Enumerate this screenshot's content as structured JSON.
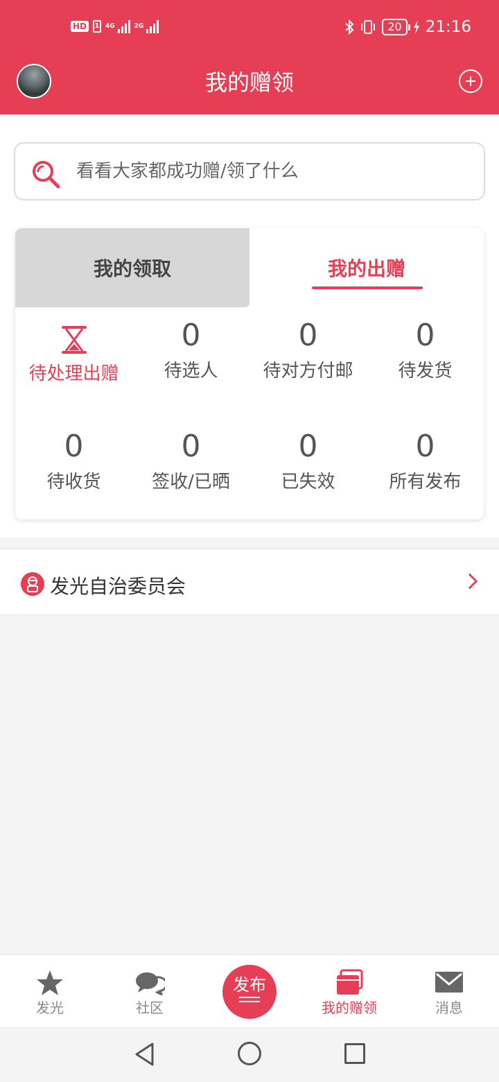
{
  "status_bar": {
    "hd": "HD",
    "sim1": "1",
    "net1": "4G",
    "net2": "2G",
    "battery": "20",
    "time": "21:16"
  },
  "header": {
    "title": "我的赠领"
  },
  "search": {
    "placeholder": "看看大家都成功赠/领了什么"
  },
  "tabs": [
    {
      "label": "我的领取"
    },
    {
      "label": "我的出赠",
      "active": true
    }
  ],
  "stats": [
    {
      "label": "待处理出赠",
      "icon": "hourglass-icon",
      "active": true
    },
    {
      "label": "待选人",
      "value": "0"
    },
    {
      "label": "待对方付邮",
      "value": "0"
    },
    {
      "label": "待发货",
      "value": "0"
    },
    {
      "label": "待收货",
      "value": "0"
    },
    {
      "label": "签收/已晒",
      "value": "0"
    },
    {
      "label": "已失效",
      "value": "0"
    },
    {
      "label": "所有发布",
      "value": "0"
    }
  ],
  "committee": {
    "label": "发光自治委员会"
  },
  "bottom_nav": {
    "items": [
      {
        "label": "发光",
        "icon": "star-icon"
      },
      {
        "label": "社区",
        "icon": "chat-icon"
      },
      {
        "label": "发布",
        "icon": "publish-icon"
      },
      {
        "label": "我的赠领",
        "icon": "cards-icon",
        "active": true
      },
      {
        "label": "消息",
        "icon": "mail-icon"
      }
    ]
  },
  "colors": {
    "accent": "#e63e54",
    "tab_inactive_bg": "#d7d7d7",
    "text": "#555555"
  }
}
